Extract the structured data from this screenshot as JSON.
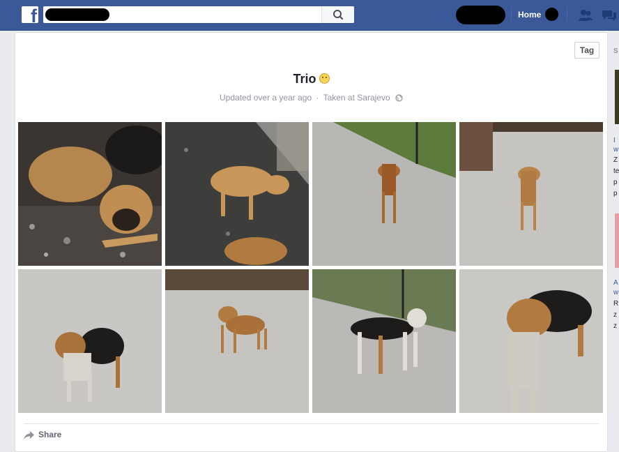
{
  "topbar": {
    "nav_home_label": "Home"
  },
  "album": {
    "tag_label": "Tag",
    "title": "Trio",
    "updated": "Updated over a year ago",
    "separator": "·",
    "location": "Taken at Sarajevo",
    "photos": [
      {
        "alt": "dog-photo-1"
      },
      {
        "alt": "dog-photo-2"
      },
      {
        "alt": "dog-photo-3"
      },
      {
        "alt": "dog-photo-4"
      },
      {
        "alt": "dog-photo-5"
      },
      {
        "alt": "dog-photo-6"
      },
      {
        "alt": "dog-photo-7"
      },
      {
        "alt": "dog-photo-8"
      }
    ],
    "share_label": "Share"
  },
  "sidebar": {
    "header_letter": "S",
    "item1_lines": [
      "I",
      "w",
      "Z",
      "te",
      "p",
      "p"
    ],
    "item2_lines": [
      "A",
      "w",
      "R",
      "z",
      "z"
    ]
  },
  "colors": {
    "brand": "#3b5998",
    "background": "#e9ebee",
    "link": "#365899"
  }
}
